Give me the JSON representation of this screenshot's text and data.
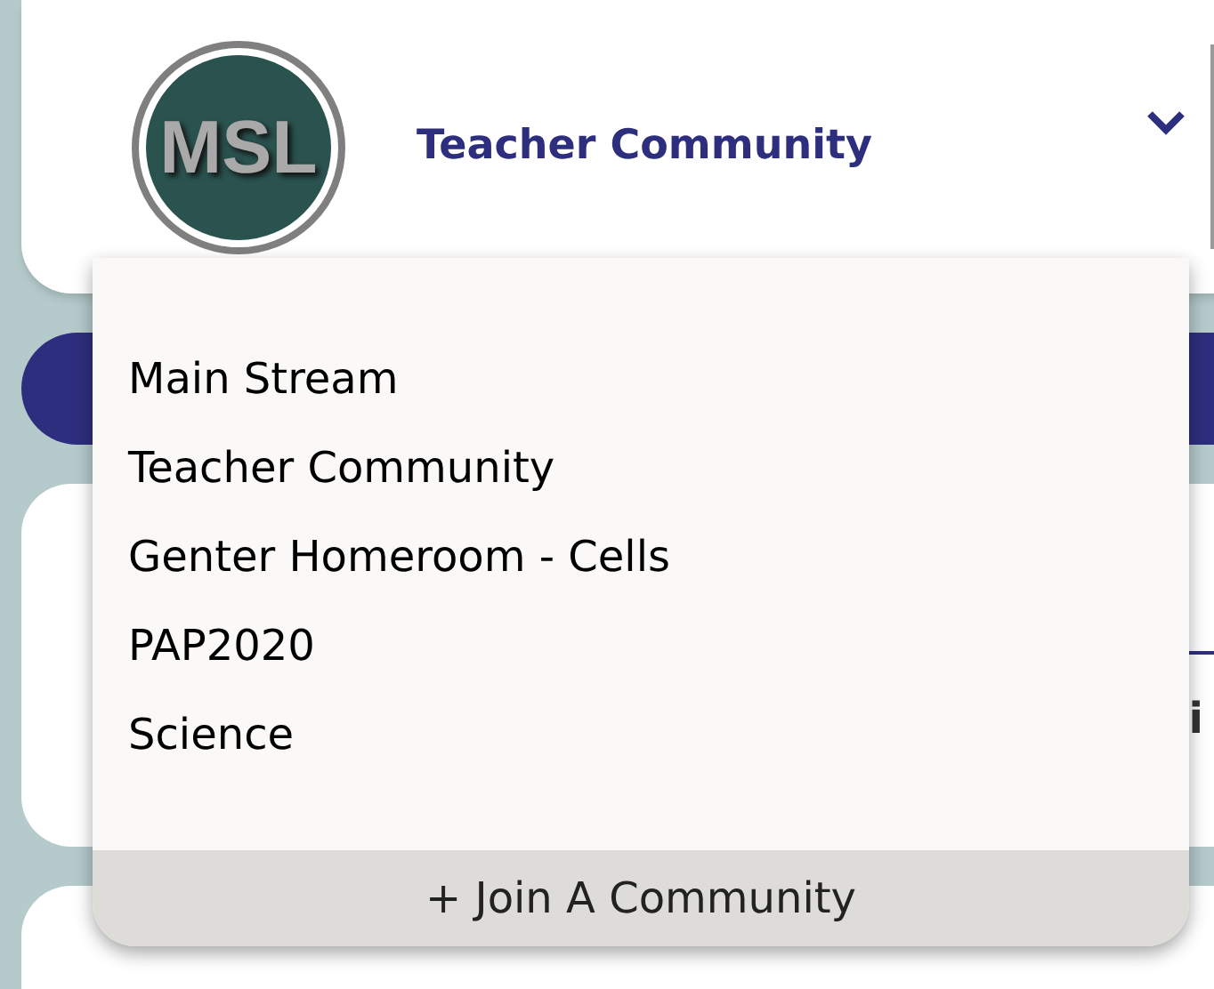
{
  "header": {
    "avatar_text": "MSL",
    "title": "Teacher Community"
  },
  "background": {
    "card_text": "i"
  },
  "dropdown": {
    "items": [
      {
        "label": "Main Stream"
      },
      {
        "label": "Teacher Community"
      },
      {
        "label": "Genter Homeroom - Cells"
      },
      {
        "label": "PAP2020"
      },
      {
        "label": "Science"
      }
    ],
    "footer": "+ Join A Community"
  }
}
